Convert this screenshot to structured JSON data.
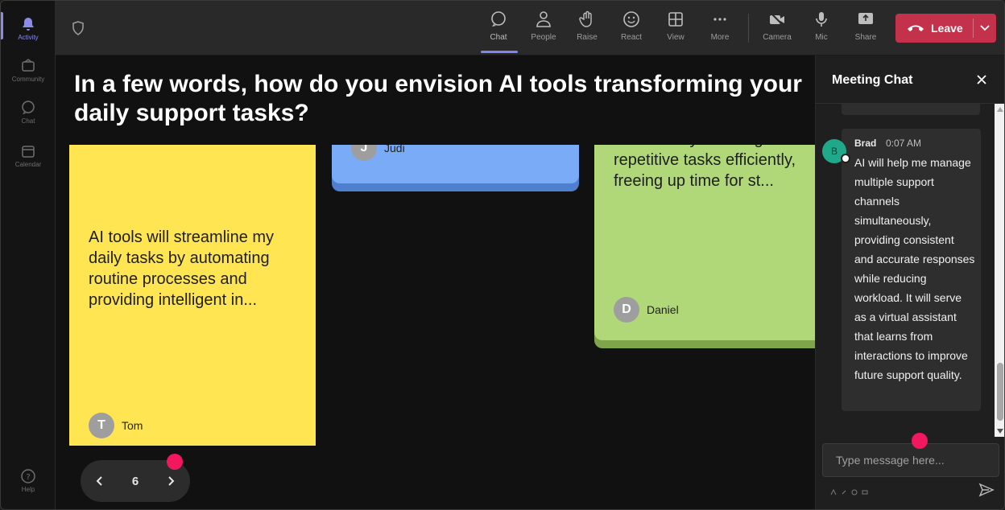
{
  "rail": {
    "items": [
      {
        "label": "Activity",
        "icon": "bell-icon"
      },
      {
        "label": "Community",
        "icon": "community-icon"
      },
      {
        "label": "Chat",
        "icon": "chat-icon"
      },
      {
        "label": "Calendar",
        "icon": "calendar-icon"
      },
      {
        "label": "Help",
        "icon": "help-icon"
      }
    ]
  },
  "toolbar": {
    "chat": "Chat",
    "people": "People",
    "raise": "Raise",
    "react": "React",
    "view": "View",
    "more": "More",
    "camera": "Camera",
    "mic": "Mic",
    "share": "Share",
    "leave": "Leave"
  },
  "stage": {
    "question": "In a few words, how do you envision AI tools transforming your daily support tasks?",
    "cards": [
      {
        "text": "AI tools will streamline my daily tasks by automating routine processes and providing intelligent in...",
        "author": "Tom",
        "initial": "T",
        "color": "#ffe552"
      },
      {
        "text": "",
        "author": "Judi",
        "initial": "J",
        "color": "#7aabf7"
      },
      {
        "text": "workflow by handling repetitive tasks efficiently, freeing up time for st...",
        "author": "Daniel",
        "initial": "D",
        "color": "#b0d879"
      }
    ],
    "pager": {
      "page": "6"
    }
  },
  "chat": {
    "title": "Meeting Chat",
    "message": {
      "avatar": "B",
      "name": "Brad",
      "time": "0:07 AM",
      "body": "AI will help me manage multiple support channels simultaneously, providing consistent and accurate responses while reducing workload. It will serve as a virtual assistant that learns from interactions to improve future support quality."
    },
    "input_placeholder": "Type message here..."
  },
  "colors": {
    "leave": "#c4314b",
    "accent": "#7f85f5",
    "marker": "#f2175f"
  }
}
